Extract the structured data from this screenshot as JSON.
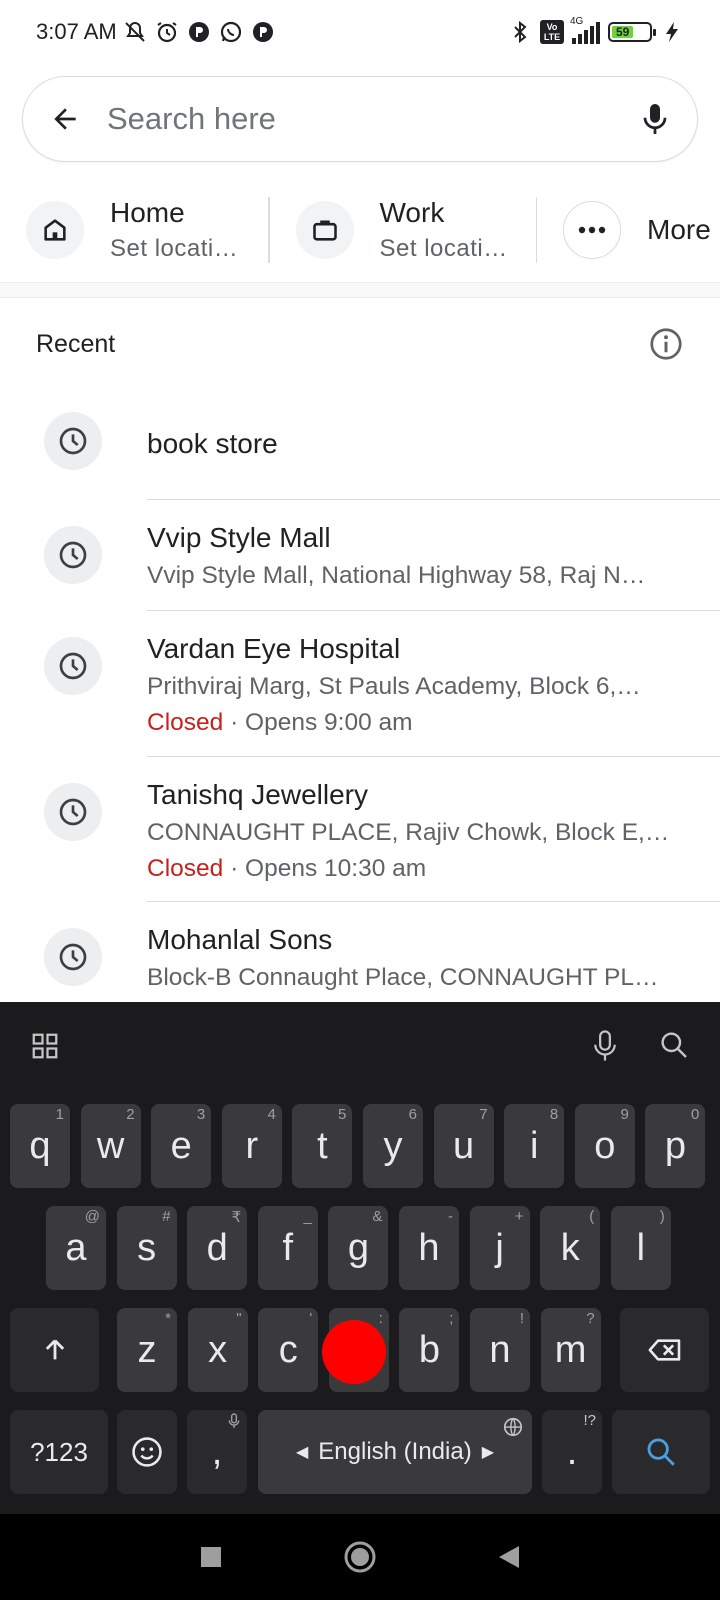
{
  "status": {
    "time": "3:07 AM",
    "network": "4G",
    "volte": "Vo LTE",
    "battery": "59"
  },
  "search": {
    "placeholder": "Search here"
  },
  "shortcuts": {
    "home_title": "Home",
    "home_sub": "Set locati…",
    "work_title": "Work",
    "work_sub": "Set locati…",
    "more_label": "More"
  },
  "recent": {
    "header": "Recent",
    "items": [
      {
        "title": "book store"
      },
      {
        "title": "Vvip Style Mall",
        "address": "Vvip Style Mall, National Highway 58, Raj N…"
      },
      {
        "title": "Vardan Eye Hospital",
        "address": "Prithviraj Marg, St Pauls Academy, Block 6,…",
        "status": "Closed",
        "hours": " · Opens 9:00 am"
      },
      {
        "title": "Tanishq Jewellery",
        "address": "CONNAUGHT PLACE, Rajiv Chowk, Block E,…",
        "status": "Closed",
        "hours": " · Opens 10:30 am"
      },
      {
        "title": "Mohanlal Sons",
        "address": "Block-B Connaught Place, CONNAUGHT PL…"
      }
    ]
  },
  "keyboard": {
    "row1": [
      [
        "q",
        "1"
      ],
      [
        "w",
        "2"
      ],
      [
        "e",
        "3"
      ],
      [
        "r",
        "4"
      ],
      [
        "t",
        "5"
      ],
      [
        "y",
        "6"
      ],
      [
        "u",
        "7"
      ],
      [
        "i",
        "8"
      ],
      [
        "o",
        "9"
      ],
      [
        "p",
        "0"
      ]
    ],
    "row2": [
      [
        "a",
        "@"
      ],
      [
        "s",
        "#"
      ],
      [
        "d",
        "₹"
      ],
      [
        "f",
        "_"
      ],
      [
        "g",
        "&"
      ],
      [
        "h",
        "-"
      ],
      [
        "j",
        "+"
      ],
      [
        "k",
        "("
      ],
      [
        "l",
        ")"
      ]
    ],
    "row3": [
      [
        "z",
        "*"
      ],
      [
        "x",
        "\""
      ],
      [
        "c",
        "'"
      ],
      [
        "v",
        ":"
      ],
      [
        "b",
        ";"
      ],
      [
        "n",
        "!"
      ],
      [
        "m",
        "?"
      ]
    ],
    "sym_label": "?123",
    "comma": ",",
    "space_label": "English (India)",
    "period": ".",
    "period_hint": "!?"
  },
  "colors": {
    "accent": "#1a73e8",
    "closed": "#c5221f",
    "keyboard_bg": "#1b1b1d",
    "key_bg": "#3a3a3c",
    "touch_dot": "#ff0000"
  }
}
